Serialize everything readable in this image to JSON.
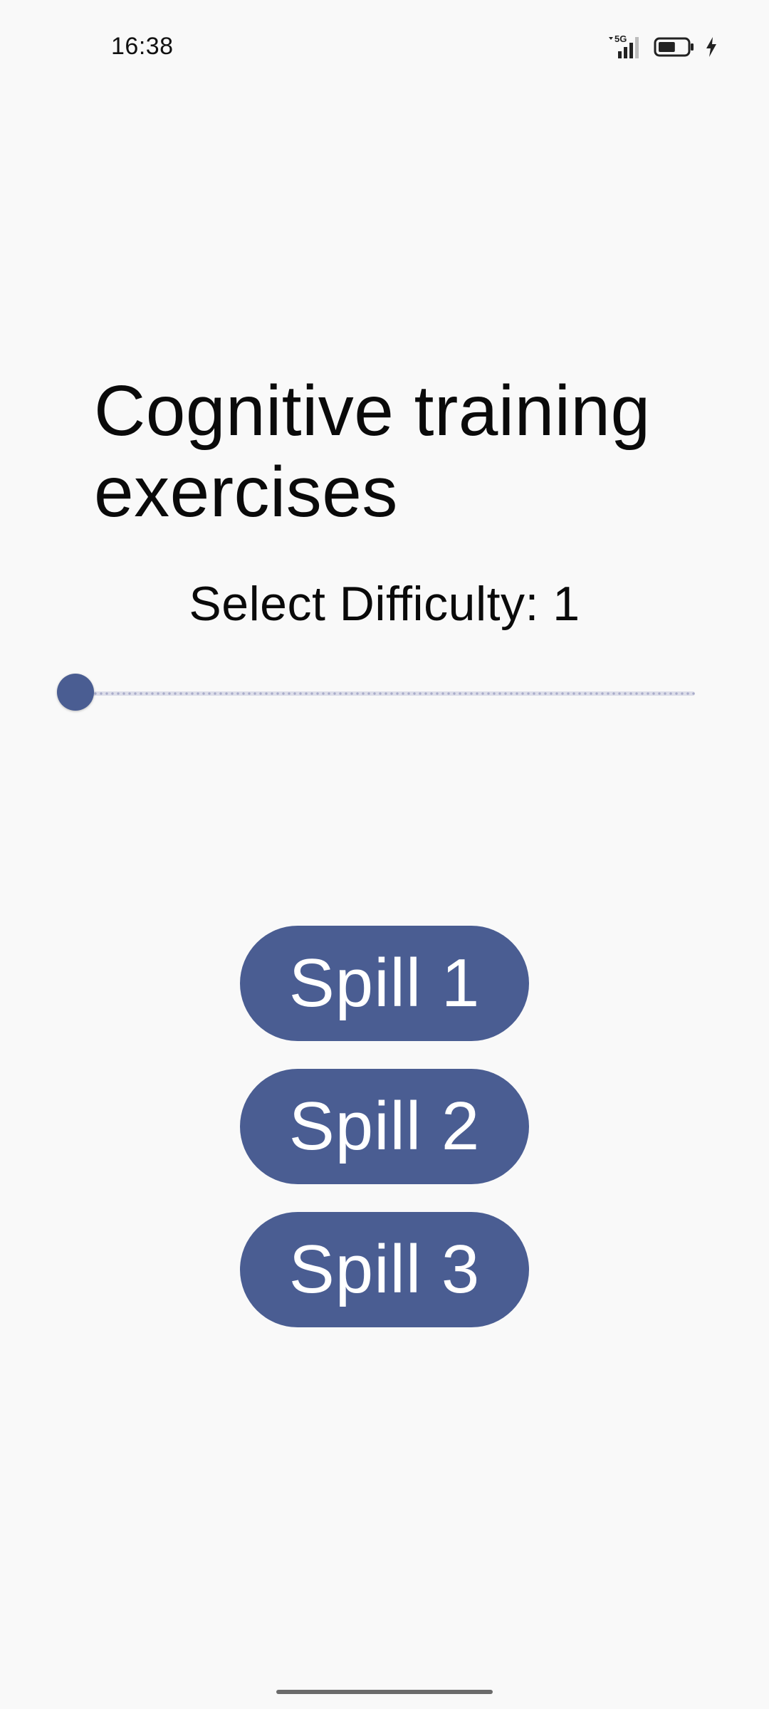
{
  "status_bar": {
    "time": "16:38",
    "network_label": "5G",
    "icons": [
      "signal-5g-icon",
      "battery-icon",
      "charging-bolt-icon"
    ],
    "battery_level": 0.6
  },
  "title": "Cognitive training exercises",
  "difficulty": {
    "label": "Select Difficulty:",
    "value": "1",
    "slider_fraction": 0.0
  },
  "buttons": [
    {
      "label": "Spill 1"
    },
    {
      "label": "Spill 2"
    },
    {
      "label": "Spill 3"
    }
  ],
  "colors": {
    "accent": "#4a5d92",
    "background": "#f9f9f9",
    "button_text": "#ffffff"
  }
}
